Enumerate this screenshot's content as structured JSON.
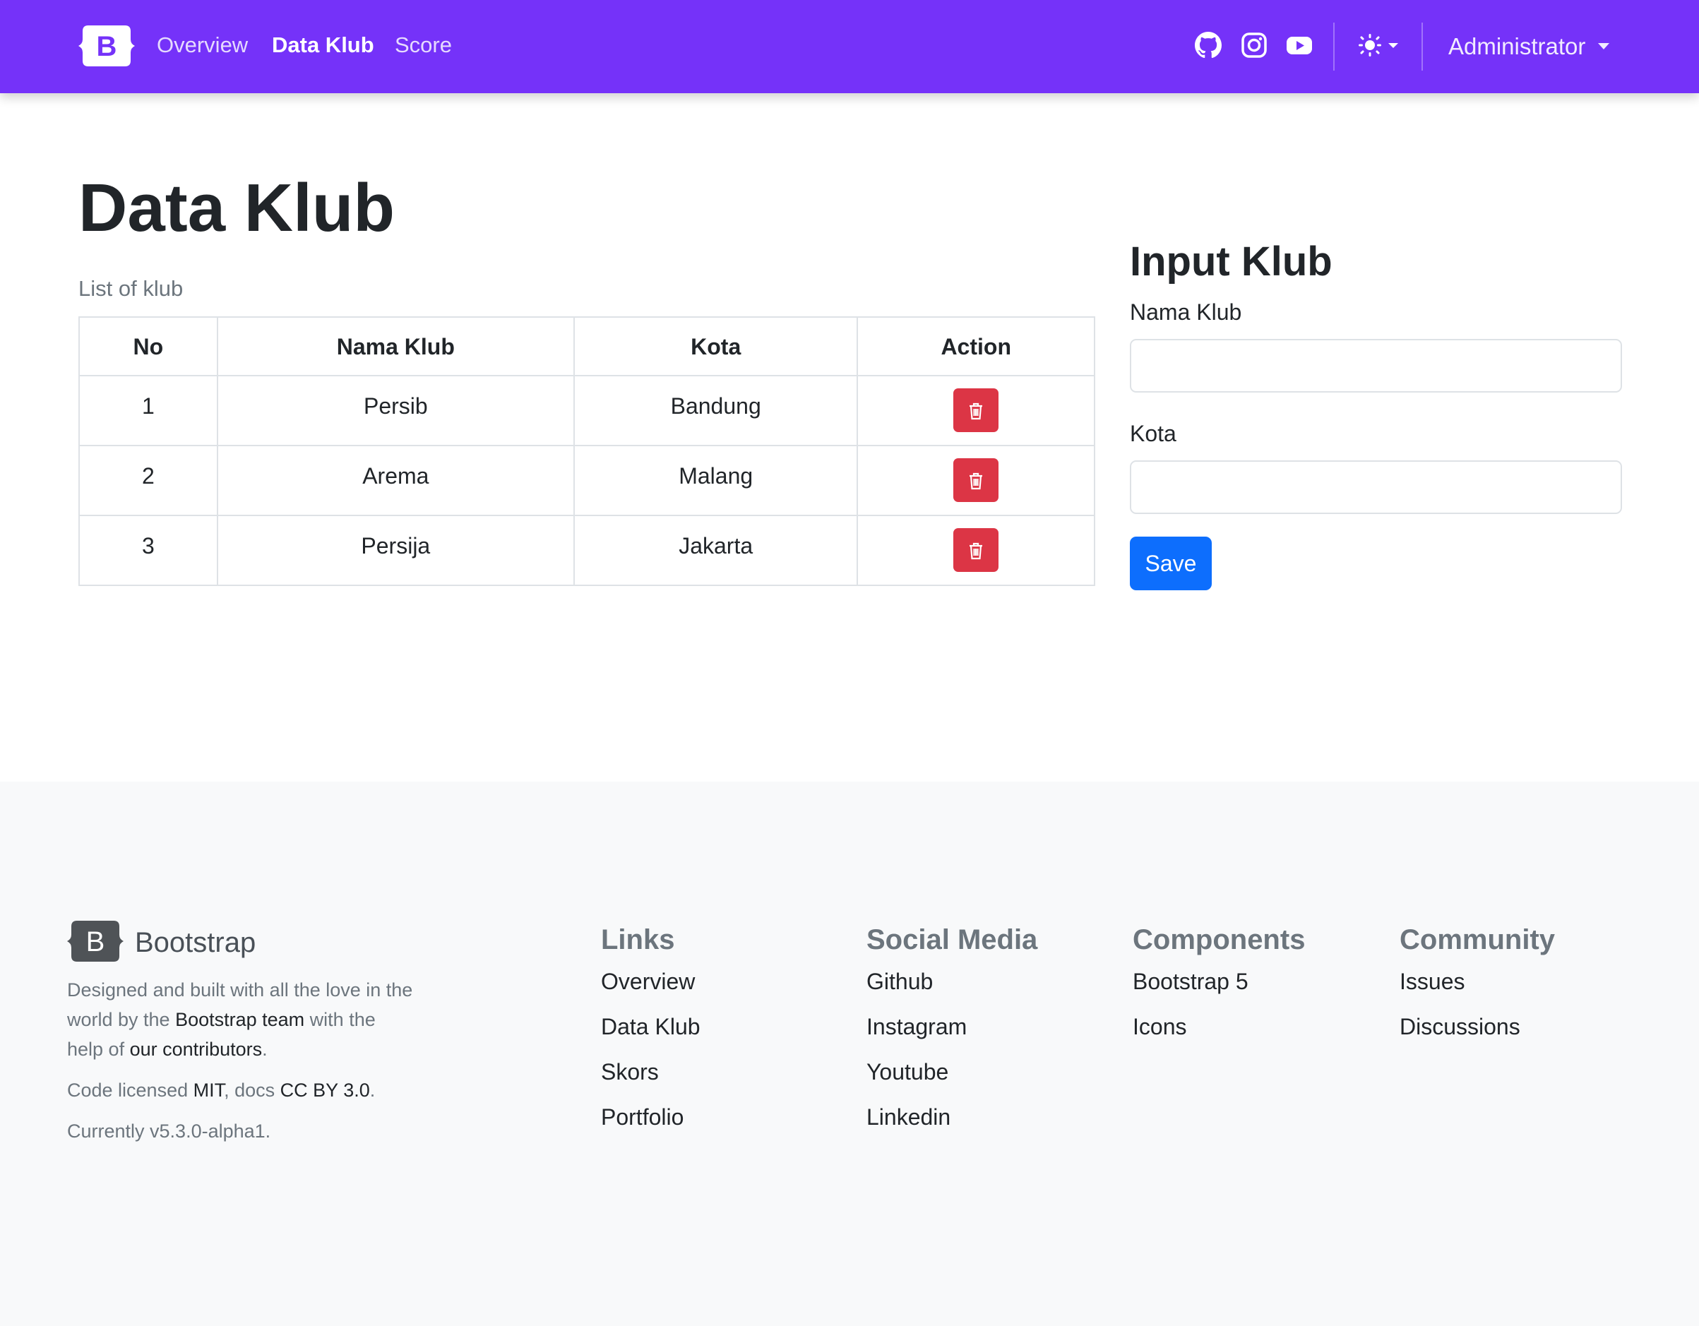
{
  "navbar": {
    "brand_letter": "B",
    "links": [
      {
        "label": "Overview",
        "active": false
      },
      {
        "label": "Data Klub",
        "active": true
      },
      {
        "label": "Score",
        "active": false
      }
    ],
    "social_icons": [
      "github-icon",
      "instagram-icon",
      "youtube-icon"
    ],
    "theme_icon": "sun-icon",
    "user_label": "Administrator",
    "background_color": "#7532f9"
  },
  "main": {
    "title": "Data Klub",
    "caption": "List of klub",
    "table": {
      "headers": [
        "No",
        "Nama Klub",
        "Kota",
        "Action"
      ],
      "rows": [
        {
          "no": "1",
          "nama": "Persib",
          "kota": "Bandung"
        },
        {
          "no": "2",
          "nama": "Arema",
          "kota": "Malang"
        },
        {
          "no": "3",
          "nama": "Persija",
          "kota": "Jakarta"
        }
      ],
      "action_icon": "trash-icon",
      "action_color": "#dc3545"
    }
  },
  "form": {
    "title": "Input Klub",
    "nama_label": "Nama Klub",
    "nama_value": "",
    "kota_label": "Kota",
    "kota_value": "",
    "save_label": "Save",
    "save_color": "#0d6efd"
  },
  "footer": {
    "brand_name": "Bootstrap",
    "about": {
      "line1": "Designed and built with all the love in the",
      "line2_pre": "world by the ",
      "line2_link": "Bootstrap team",
      "line2_post": " with the",
      "line3_pre": "help of ",
      "line3_link": "our contributors",
      "line3_post": "."
    },
    "license": {
      "pre": "Code licensed ",
      "mit": "MIT",
      "mid": ", docs ",
      "cc": "CC BY 3.0",
      "post": "."
    },
    "version": "Currently v5.3.0-alpha1.",
    "columns": [
      {
        "title": "Links",
        "items": [
          "Overview",
          "Data Klub",
          "Skors",
          "Portfolio"
        ]
      },
      {
        "title": "Social Media",
        "items": [
          "Github",
          "Instagram",
          "Youtube",
          "Linkedin"
        ]
      },
      {
        "title": "Components",
        "items": [
          "Bootstrap 5",
          "Icons"
        ]
      },
      {
        "title": "Community",
        "items": [
          "Issues",
          "Discussions"
        ]
      }
    ]
  }
}
